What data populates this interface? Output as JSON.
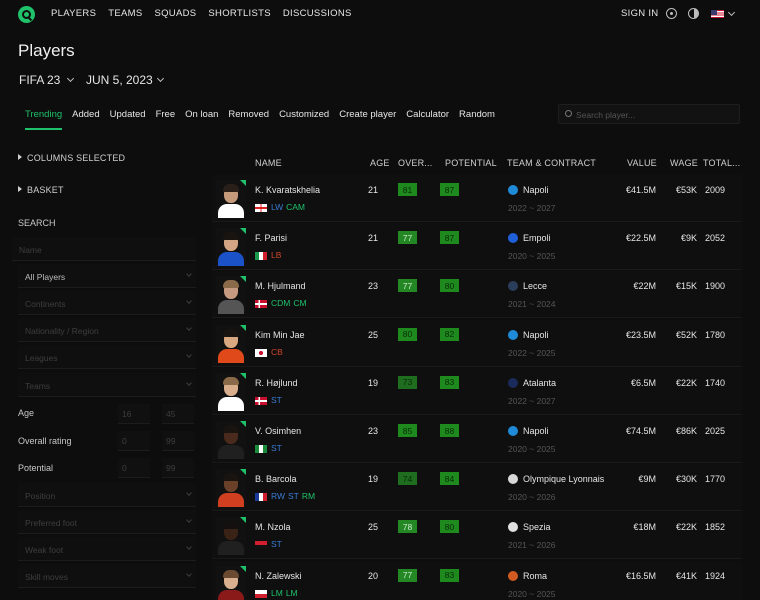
{
  "nav": {
    "links": [
      "PLAYERS",
      "TEAMS",
      "SQUADS",
      "SHORTLISTS",
      "DISCUSSIONS"
    ],
    "sign_in": "SIGN IN",
    "icons": [
      "gear-icon",
      "theme-toggle-icon",
      "us-flag-icon"
    ]
  },
  "page": {
    "title": "Players",
    "game": "FIFA 23",
    "date": "JUN 5, 2023"
  },
  "tabs": [
    "Trending",
    "Added",
    "Updated",
    "Free",
    "On loan",
    "Removed",
    "Customized",
    "Create player",
    "Calculator",
    "Random"
  ],
  "search": {
    "placeholder": "Search player..."
  },
  "sidebar": {
    "columns_selected": "COLUMNS SELECTED",
    "basket": "BASKET",
    "search_heading": "SEARCH",
    "name_placeholder": "Name",
    "players_scope": "All Players",
    "continents": "Continents",
    "nationality": "Nationality / Region",
    "leagues": "Leagues",
    "teams": "Teams",
    "age_label": "Age",
    "age_min": "16",
    "age_max": "45",
    "overall_label": "Overall rating",
    "overall_min": "0",
    "overall_max": "99",
    "potential_label": "Potential",
    "potential_min": "0",
    "potential_max": "99",
    "position": "Position",
    "preferred_foot": "Preferred foot",
    "weak_foot": "Weak foot",
    "skill_moves": "Skill moves"
  },
  "table": {
    "headers": {
      "name": "NAME",
      "age": "AGE",
      "overall": "OVER...",
      "potential": "POTENTIAL",
      "team": "TEAM & CONTRACT",
      "value": "VALUE",
      "wage": "WAGE",
      "total": "TOTAL..."
    },
    "rows": [
      {
        "name": "K. Kvaratskhelia",
        "flag": "georgia",
        "positions": [
          "LW",
          "CAM"
        ],
        "pos_colors": [
          "#3a7bd5",
          "#1fc26b"
        ],
        "age": "21",
        "ovr": "81",
        "pot": "87",
        "club": "Napoli",
        "club_color": "#1f8ad8",
        "contract": "2022 ~ 2027",
        "value": "€41.5M",
        "wage": "€53K",
        "total": "2009",
        "skin": "#c59a7a",
        "hair": "#2a1f18",
        "shirt": "#ffffff"
      },
      {
        "name": "F. Parisi",
        "flag": "italy",
        "positions": [
          "LB"
        ],
        "pos_colors": [
          "#d0452b"
        ],
        "age": "21",
        "ovr": "77",
        "pot": "87",
        "club": "Empoli",
        "club_color": "#1f5fd8",
        "contract": "2020 ~ 2025",
        "value": "€22.5M",
        "wage": "€9K",
        "total": "2052",
        "skin": "#d2a684",
        "hair": "#1a1410",
        "shirt": "#1c52c8"
      },
      {
        "name": "M. Hjulmand",
        "flag": "denmark",
        "positions": [
          "CDM",
          "CM"
        ],
        "pos_colors": [
          "#1fc26b",
          "#1fc26b"
        ],
        "age": "23",
        "ovr": "77",
        "pot": "80",
        "club": "Lecce",
        "club_color": "#2a3d5a",
        "contract": "2021 ~ 2024",
        "value": "€22M",
        "wage": "€15K",
        "total": "1900",
        "skin": "#c69a80",
        "hair": "#8a6a48",
        "shirt": "#555555"
      },
      {
        "name": "Kim Min Jae",
        "flag": "korea",
        "positions": [
          "CB"
        ],
        "pos_colors": [
          "#d0452b"
        ],
        "age": "25",
        "ovr": "80",
        "pot": "82",
        "club": "Napoli",
        "club_color": "#1f8ad8",
        "contract": "2022 ~ 2025",
        "value": "€23.5M",
        "wage": "€52K",
        "total": "1780",
        "skin": "#d8a880",
        "hair": "#1a1410",
        "shirt": "#e04a1a"
      },
      {
        "name": "R. Højlund",
        "flag": "denmark",
        "positions": [
          "ST"
        ],
        "pos_colors": [
          "#3a7bd5"
        ],
        "age": "19",
        "ovr": "73",
        "pot": "83",
        "club": "Atalanta",
        "club_color": "#1a2a5a",
        "contract": "2022 ~ 2027",
        "value": "€6.5M",
        "wage": "€22K",
        "total": "1740",
        "skin": "#d8ae8c",
        "hair": "#8a6a48",
        "shirt": "#ffffff"
      },
      {
        "name": "V. Osimhen",
        "flag": "nigeria",
        "positions": [
          "ST"
        ],
        "pos_colors": [
          "#3a7bd5"
        ],
        "age": "23",
        "ovr": "85",
        "pot": "88",
        "club": "Napoli",
        "club_color": "#1f8ad8",
        "contract": "2020 ~ 2025",
        "value": "€74.5M",
        "wage": "€86K",
        "total": "2025",
        "skin": "#4a2a1c",
        "hair": "#1a1410",
        "shirt": "#202020"
      },
      {
        "name": "B. Barcola",
        "flag": "france",
        "positions": [
          "RW",
          "ST",
          "RM"
        ],
        "pos_colors": [
          "#3a7bd5",
          "#3a7bd5",
          "#1fc26b"
        ],
        "age": "19",
        "ovr": "74",
        "pot": "84",
        "club": "Olympique Lyonnais",
        "club_color": "#d8d8d8",
        "contract": "2020 ~ 2026",
        "value": "€9M",
        "wage": "€30K",
        "total": "1770",
        "skin": "#6a4028",
        "hair": "#1a1410",
        "shirt": "#d04020"
      },
      {
        "name": "M. Nzola",
        "flag": "angola",
        "positions": [
          "ST"
        ],
        "pos_colors": [
          "#3a7bd5"
        ],
        "age": "25",
        "ovr": "78",
        "pot": "80",
        "club": "Spezia",
        "club_color": "#e0e0e0",
        "contract": "2021 ~ 2026",
        "value": "€18M",
        "wage": "€22K",
        "total": "1852",
        "skin": "#3a2216",
        "hair": "#141010",
        "shirt": "#202020"
      },
      {
        "name": "N. Zalewski",
        "flag": "poland",
        "positions": [
          "LM",
          "LM"
        ],
        "pos_colors": [
          "#1fc26b",
          "#1fc26b"
        ],
        "age": "20",
        "ovr": "77",
        "pot": "83",
        "club": "Roma",
        "club_color": "#d05a20",
        "contract": "2020 ~ 2025",
        "value": "€16.5M",
        "wage": "€41K",
        "total": "1924",
        "skin": "#d8b090",
        "hair": "#6a4a30",
        "shirt": "#8a1a1a"
      }
    ]
  }
}
